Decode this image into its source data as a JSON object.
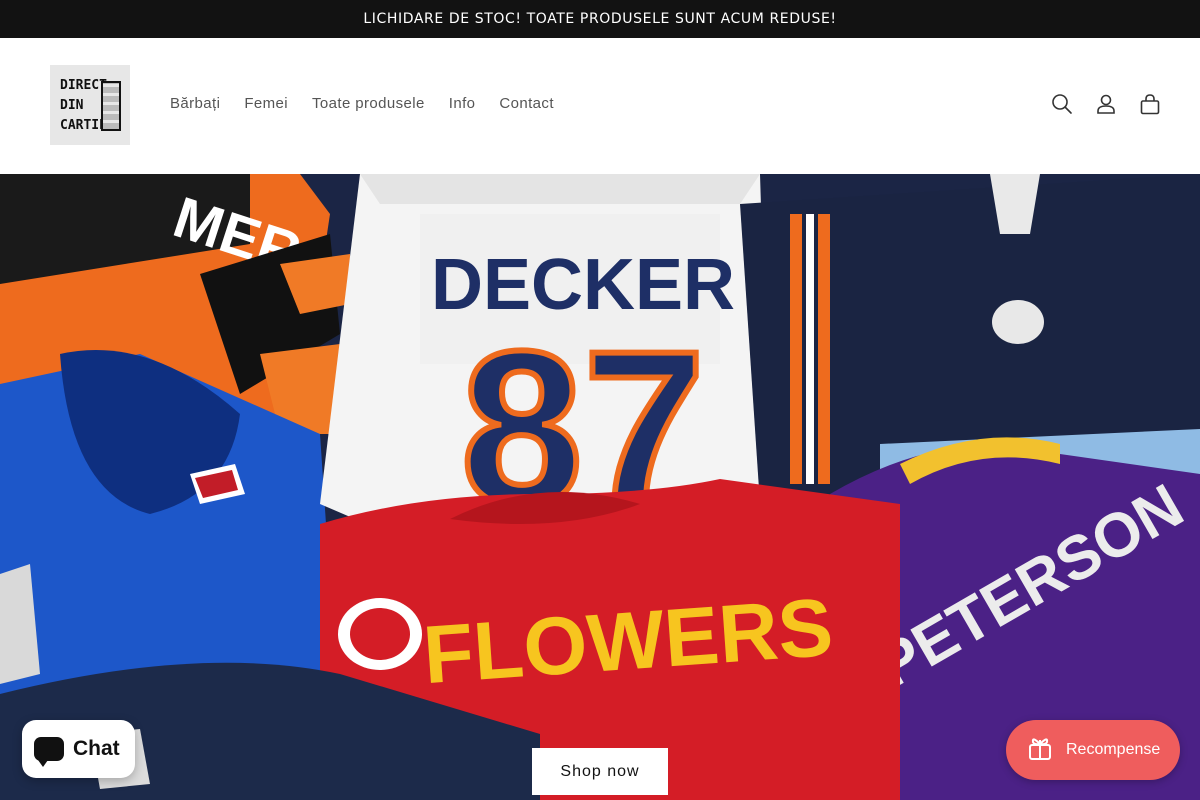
{
  "announcement": "LICHIDARE DE STOC! TOATE PRODUSELE SUNT ACUM REDUSE!",
  "logo": {
    "lines": [
      "DIRECT",
      "DIN",
      "CARTIER"
    ]
  },
  "nav": {
    "items": [
      "Bărbați",
      "Femei",
      "Toate produsele",
      "Info",
      "Contact"
    ]
  },
  "header_icons": [
    "search-icon",
    "account-icon",
    "cart-icon"
  ],
  "hero": {
    "jersey_texts": {
      "decker": "DECKER",
      "number": "87",
      "flowers": "FLOWERS",
      "peterson": "PETERSON",
      "top_left": "MER"
    },
    "button_label": "Shop now"
  },
  "chat_widget": {
    "label": "Chat"
  },
  "rewards_widget": {
    "label": "Recompense"
  },
  "colors": {
    "announcement_bg": "#121212",
    "rewards_bg": "#ef5d5d",
    "nav_text": "#555555"
  }
}
